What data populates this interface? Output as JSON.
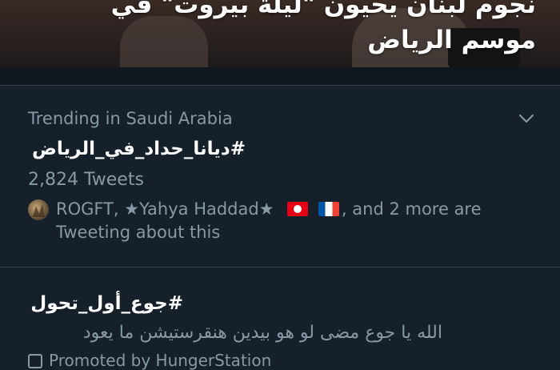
{
  "hero": {
    "headline_line1": "نجوم لبنان يحيون \"ليلة بيروت\" في",
    "headline_line2": "موسم الرياض"
  },
  "trends": [
    {
      "context": "Trending in Saudi Arabia",
      "hashtag": "#ديانا_حداد_في_الرياض",
      "count": "2,824 Tweets",
      "tweeting_names": "ROGFT, ★Yahya Haddad★",
      "tweeting_rest": ", and 2 more are",
      "tweeting_line2": "Tweeting about this",
      "flags": [
        "tunisia-flag",
        "france-flag"
      ]
    },
    {
      "hashtag": "#جوع_أول_تحول",
      "description": "الله يا جوع مضى لو هو بيدين هنقرستيشن ما يعود",
      "promoted": "Promoted by HungerStation"
    }
  ],
  "colors": {
    "background": "#15202b",
    "secondary_text": "#8899a6",
    "divider": "#38444d"
  },
  "icons": [
    "chevron-down-icon",
    "promoted-icon"
  ]
}
